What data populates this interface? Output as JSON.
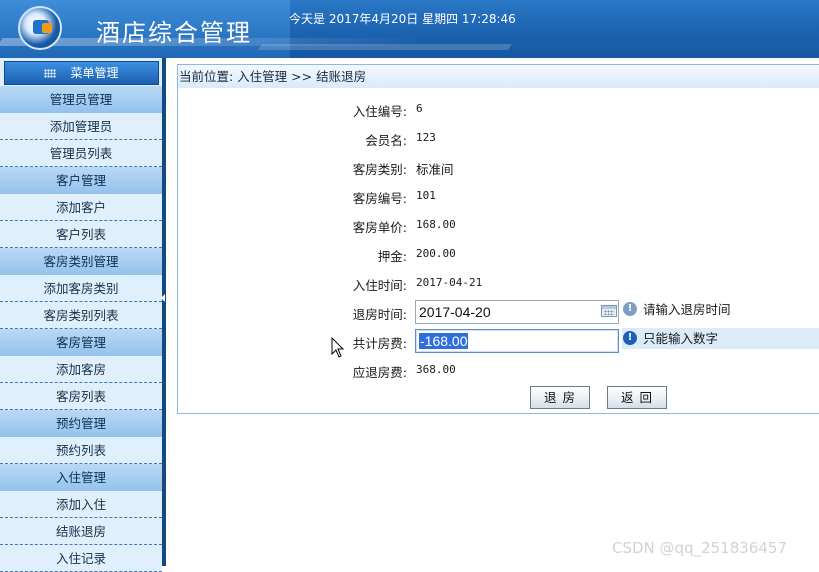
{
  "header": {
    "title": "酒店综合管理",
    "date_line": "今天是 2017年4月20日 星期四 17:28:46"
  },
  "sidebar": {
    "menu_label": "菜单管理",
    "items": [
      {
        "label": "管理员管理",
        "type": "group"
      },
      {
        "label": "添加管理员",
        "type": "item"
      },
      {
        "label": "管理员列表",
        "type": "item"
      },
      {
        "label": "客户管理",
        "type": "group"
      },
      {
        "label": "添加客户",
        "type": "item"
      },
      {
        "label": "客户列表",
        "type": "item"
      },
      {
        "label": "客房类别管理",
        "type": "group"
      },
      {
        "label": "添加客房类别",
        "type": "item"
      },
      {
        "label": "客房类别列表",
        "type": "item"
      },
      {
        "label": "客房管理",
        "type": "group"
      },
      {
        "label": "添加客房",
        "type": "item"
      },
      {
        "label": "客房列表",
        "type": "item"
      },
      {
        "label": "预约管理",
        "type": "group"
      },
      {
        "label": "预约列表",
        "type": "item"
      },
      {
        "label": "入住管理",
        "type": "group"
      },
      {
        "label": "添加入住",
        "type": "item"
      },
      {
        "label": "结账退房",
        "type": "item"
      },
      {
        "label": "入住记录",
        "type": "item"
      }
    ]
  },
  "breadcrumb": "当前位置: 入住管理 >> 结账退房",
  "form": {
    "fields": [
      {
        "label": "入住编号:",
        "value": "6"
      },
      {
        "label": "会员名:",
        "value": "123"
      },
      {
        "label": "客房类别:",
        "value": "标准间"
      },
      {
        "label": "客房编号:",
        "value": "101"
      },
      {
        "label": "客房单价:",
        "value": "168.00"
      },
      {
        "label": "押金:",
        "value": "200.00"
      },
      {
        "label": "入住时间:",
        "value": "2017-04-21"
      }
    ],
    "checkout_time": {
      "label": "退房时间:",
      "value": "2017-04-20",
      "hint": "请输入退房时间"
    },
    "total_fee": {
      "label": "共计房费:",
      "value": "-168.00",
      "hint": "只能输入数字"
    },
    "refund": {
      "label": "应退房费:",
      "value": "368.00"
    },
    "checkout_button": "退房",
    "back_button": "返回"
  },
  "watermark": "CSDN @qq_251836457"
}
